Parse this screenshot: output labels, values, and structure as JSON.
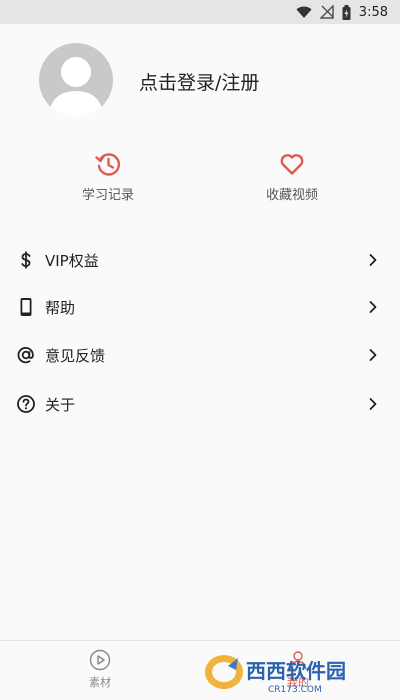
{
  "status_bar": {
    "time": "3:58"
  },
  "profile": {
    "login_text": "点击登录/注册"
  },
  "quick_actions": [
    {
      "label": "学习记录",
      "icon": "history-icon"
    },
    {
      "label": "收藏视频",
      "icon": "heart-icon"
    }
  ],
  "menu": [
    {
      "label": "VIP权益",
      "icon": "dollar-icon"
    },
    {
      "label": "帮助",
      "icon": "phone-icon"
    },
    {
      "label": "意见反馈",
      "icon": "at-sign-icon"
    },
    {
      "label": "关于",
      "icon": "question-circle-icon"
    }
  ],
  "bottom_nav": [
    {
      "label": "素材",
      "icon": "play-circle-icon"
    },
    {
      "label": "我的",
      "icon": "user-icon"
    }
  ],
  "watermark": {
    "brand": "西西软件园",
    "url": "CR173.COM"
  },
  "colors": {
    "accent": "#e05a4e",
    "avatar": "#c9c9c9",
    "background": "#fafafa"
  }
}
